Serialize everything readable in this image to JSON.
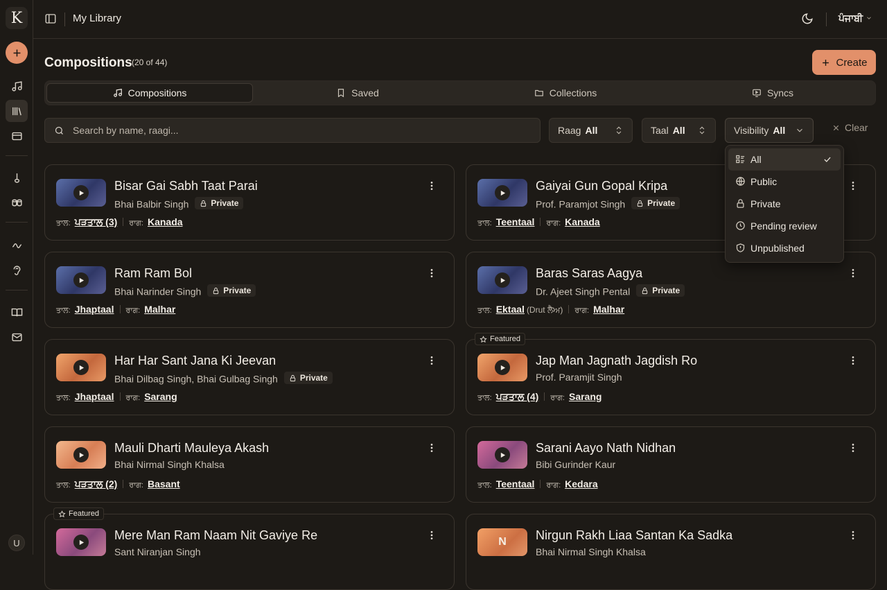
{
  "app": {
    "logo_letter": "K"
  },
  "topbar": {
    "title": "My Library",
    "language": "ਪੰਜਾਬੀ"
  },
  "header": {
    "title": "Compositions",
    "count": "(20 of 44)",
    "create_label": "Create"
  },
  "tabs": [
    {
      "label": "Compositions",
      "icon": "music-note-icon",
      "active": true
    },
    {
      "label": "Saved",
      "icon": "bookmark-icon",
      "active": false
    },
    {
      "label": "Collections",
      "icon": "folder-icon",
      "active": false
    },
    {
      "label": "Syncs",
      "icon": "monitor-play-icon",
      "active": false
    }
  ],
  "search": {
    "placeholder": "Search by name, raagi..."
  },
  "filters": {
    "raag": {
      "label": "Raag",
      "value": "All"
    },
    "taal": {
      "label": "Taal",
      "value": "All"
    },
    "visibility": {
      "label": "Visibility",
      "value": "All"
    },
    "clear_label": "Clear"
  },
  "visibility_menu": [
    {
      "label": "All",
      "icon": "list-icon",
      "selected": true
    },
    {
      "label": "Public",
      "icon": "globe-icon",
      "selected": false
    },
    {
      "label": "Private",
      "icon": "lock-icon",
      "selected": false
    },
    {
      "label": "Pending review",
      "icon": "clock-icon",
      "selected": false
    },
    {
      "label": "Unpublished",
      "icon": "shield-alert-icon",
      "selected": false
    }
  ],
  "labels": {
    "taal": "ਤਾਲ:",
    "raag": "ਰਾਗ:",
    "private": "Private",
    "featured": "Featured"
  },
  "compositions": [
    {
      "title": "Bisar Gai Sabh Taat Parai",
      "artist": "Bhai Balbir Singh",
      "private": true,
      "featured": false,
      "taal": "ਪੜਤਾਲ (3)",
      "taal_sub": "",
      "raag": "Kanada",
      "thumb": "blue"
    },
    {
      "title": "Gaiyai Gun Gopal Kripa",
      "artist": "Prof. Paramjot Singh",
      "private": true,
      "featured": false,
      "taal": "Teentaal",
      "taal_sub": "",
      "raag": "Kanada",
      "thumb": "blue"
    },
    {
      "title": "Ram Ram Bol",
      "artist": "Bhai Narinder Singh",
      "private": true,
      "featured": false,
      "taal": "Jhaptaal",
      "taal_sub": "",
      "raag": "Malhar",
      "thumb": "blue"
    },
    {
      "title": "Baras Saras Aagya",
      "artist": "Dr. Ajeet Singh Pental",
      "private": true,
      "featured": false,
      "taal": "Ektaal",
      "taal_sub": "(Drut ਲੈਅ)",
      "raag": "Malhar",
      "thumb": "blue"
    },
    {
      "title": "Har Har Sant Jana Ki Jeevan",
      "artist": "Bhai Dilbag Singh, Bhai Gulbag Singh",
      "private": true,
      "featured": false,
      "taal": "Jhaptaal",
      "taal_sub": "",
      "raag": "Sarang",
      "thumb": "orange"
    },
    {
      "title": "Jap Man Jagnath Jagdish Ro",
      "artist": "Prof. Paramjit Singh",
      "private": false,
      "featured": true,
      "taal": "ਪੜਤਾਲ (4)",
      "taal_sub": "",
      "raag": "Sarang",
      "thumb": "orange"
    },
    {
      "title": "Mauli Dharti Mauleya Akash",
      "artist": "Bhai Nirmal Singh Khalsa",
      "private": false,
      "featured": false,
      "taal": "ਪੜਤਾਲ (2)",
      "taal_sub": "",
      "raag": "Basant",
      "thumb": "peach"
    },
    {
      "title": "Sarani Aayo Nath Nidhan",
      "artist": "Bibi Gurinder Kaur",
      "private": false,
      "featured": false,
      "taal": "Teentaal",
      "taal_sub": "",
      "raag": "Kedara",
      "thumb": "pink"
    },
    {
      "title": "Mere Man Ram Naam Nit Gaviye Re",
      "artist": "Sant Niranjan Singh",
      "private": false,
      "featured": true,
      "taal": "",
      "taal_sub": "",
      "raag": "",
      "thumb": "pink"
    },
    {
      "title": "Nirgun Rakh Liaa Santan Ka Sadka",
      "artist": "Bhai Nirmal Singh Khalsa",
      "private": false,
      "featured": false,
      "taal": "",
      "taal_sub": "",
      "raag": "",
      "thumb": "letter",
      "letter": "N"
    }
  ],
  "user": {
    "avatar_letter": "U"
  },
  "colors": {
    "accent": "#e2906a",
    "background": "#1d1a16",
    "surface": "#2b2722"
  }
}
